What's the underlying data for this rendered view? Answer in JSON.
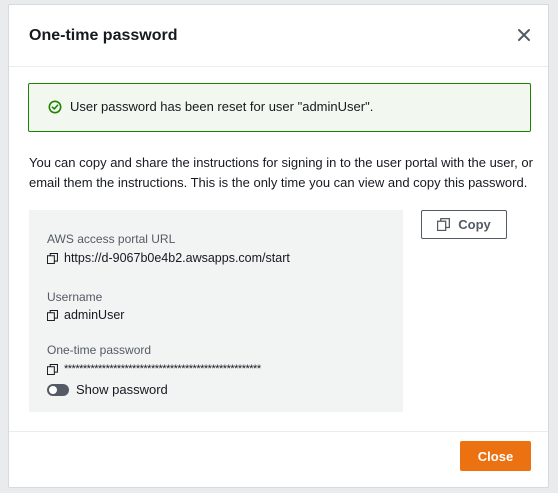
{
  "modal": {
    "title": "One-time password",
    "close_icon": "close-icon"
  },
  "alert": {
    "icon": "check-circle-icon",
    "message": "User password has been reset for user \"adminUser\".",
    "colors": {
      "border": "#1d8102",
      "background": "#f2f8f0"
    }
  },
  "instructions": "You can copy and share the instructions for signing in to the user portal with the user, or email them the instructions. This is the only time you can view and copy this password.",
  "credentials": {
    "portal_url_label": "AWS access portal URL",
    "portal_url": "https://d-9067b0e4b2.awsapps.com/start",
    "username_label": "Username",
    "username": "adminUser",
    "password_label": "One-time password",
    "password_masked": "****************************************************",
    "show_password_label": "Show password",
    "show_password_enabled": false,
    "copy_icon": "copy-icon"
  },
  "buttons": {
    "copy_label": "Copy",
    "close_label": "Close",
    "close_color": "#ec7211"
  }
}
